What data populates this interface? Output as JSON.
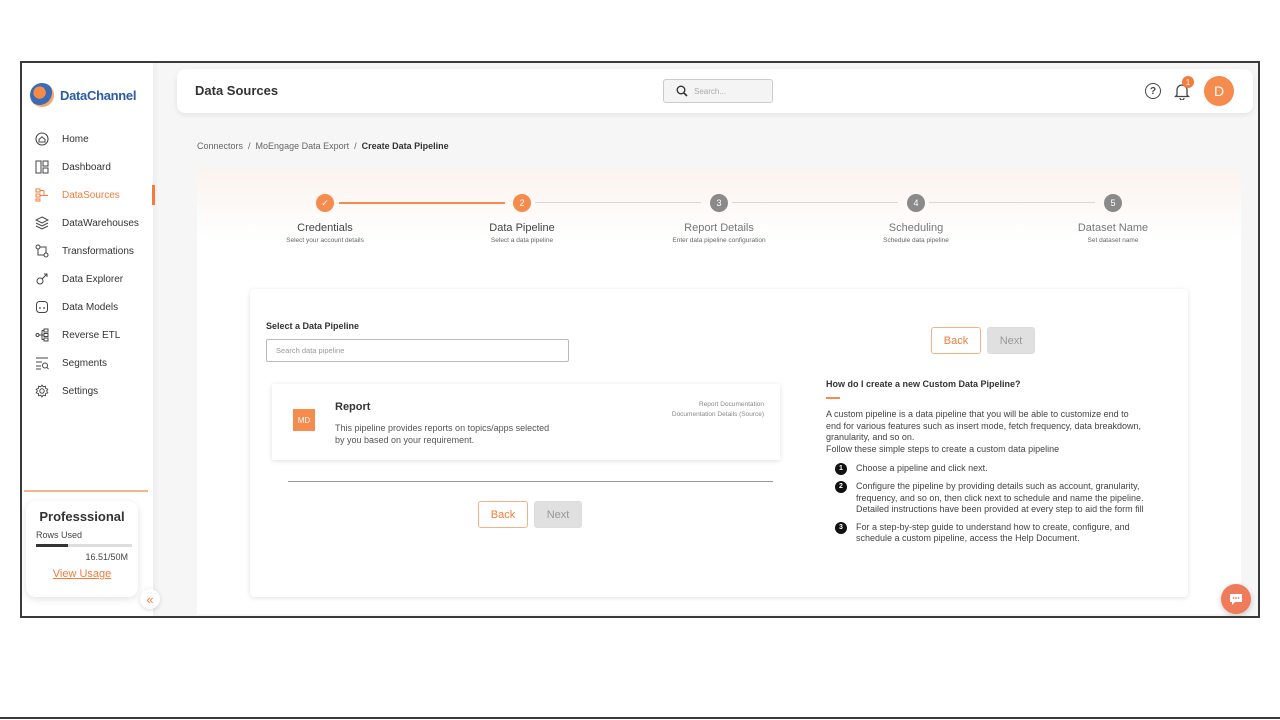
{
  "app": {
    "logo_text": "DataChannel"
  },
  "sidebar": {
    "items": [
      {
        "label": "Home",
        "icon": "home-icon"
      },
      {
        "label": "Dashboard",
        "icon": "dashboard-icon"
      },
      {
        "label": "DataSources",
        "icon": "datasources-icon",
        "active": true
      },
      {
        "label": "DataWarehouses",
        "icon": "warehouse-icon"
      },
      {
        "label": "Transformations",
        "icon": "transform-icon"
      },
      {
        "label": "Data Explorer",
        "icon": "explorer-icon"
      },
      {
        "label": "Data Models",
        "icon": "models-icon"
      },
      {
        "label": "Reverse ETL",
        "icon": "reverse-etl-icon"
      },
      {
        "label": "Segments",
        "icon": "segments-icon"
      },
      {
        "label": "Settings",
        "icon": "gear-icon"
      }
    ],
    "plan": {
      "title": "Professsional",
      "rows_label": "Rows Used",
      "used_text": "16.51/50M",
      "used_fraction": 0.33,
      "link": "View Usage"
    },
    "collapse_glyph": "«"
  },
  "header": {
    "title": "Data Sources",
    "search_placeholder": "Search...",
    "notification_count": "1",
    "avatar_initial": "D"
  },
  "breadcrumb": {
    "items": [
      "Connectors",
      "MoEngage Data Export"
    ],
    "current": "Create Data Pipeline",
    "separator": "/"
  },
  "stepper": {
    "steps": [
      {
        "number": "✓",
        "label": "Credentials",
        "sub": "Select your account details",
        "state": "done"
      },
      {
        "number": "2",
        "label": "Data Pipeline",
        "sub": "Select a data pipeline",
        "state": "active"
      },
      {
        "number": "3",
        "label": "Report Details",
        "sub": "Enter data pipeline configuration",
        "state": "pending"
      },
      {
        "number": "4",
        "label": "Scheduling",
        "sub": "Schedule data pipeline",
        "state": "pending"
      },
      {
        "number": "5",
        "label": "Dataset Name",
        "sub": "Set dataset name",
        "state": "pending"
      }
    ]
  },
  "main": {
    "select_title": "Select a Data Pipeline",
    "search_placeholder": "Search data pipeline",
    "pipeline": {
      "badge": "MD",
      "title": "Report",
      "description": "This pipeline provides reports on topics/apps selected by you based on your requirement.",
      "link1": "Report Documentation",
      "link2": "Documentation Details (Source)"
    },
    "back_label": "Back",
    "next_label": "Next"
  },
  "help": {
    "question": "How do I create a new Custom Data Pipeline?",
    "paragraph1": "A custom pipeline is a data pipeline that you will be able to customize end to end for various features such as insert mode, fetch frequency, data breakdown, granularity, and so on.",
    "paragraph2": "Follow these simple steps to create a custom data pipeline",
    "steps": [
      {
        "n": "1",
        "text": "Choose a pipeline and click next."
      },
      {
        "n": "2",
        "text": "Configure the pipeline by providing details such as account, granularity, frequency, and so on, then click next to schedule and name the pipeline. Detailed instructions have been provided at every step to aid the form fill"
      },
      {
        "n": "3",
        "text": "For a step-by-step guide to understand how to create, configure, and schedule a custom pipeline, access the Help Document."
      }
    ]
  }
}
